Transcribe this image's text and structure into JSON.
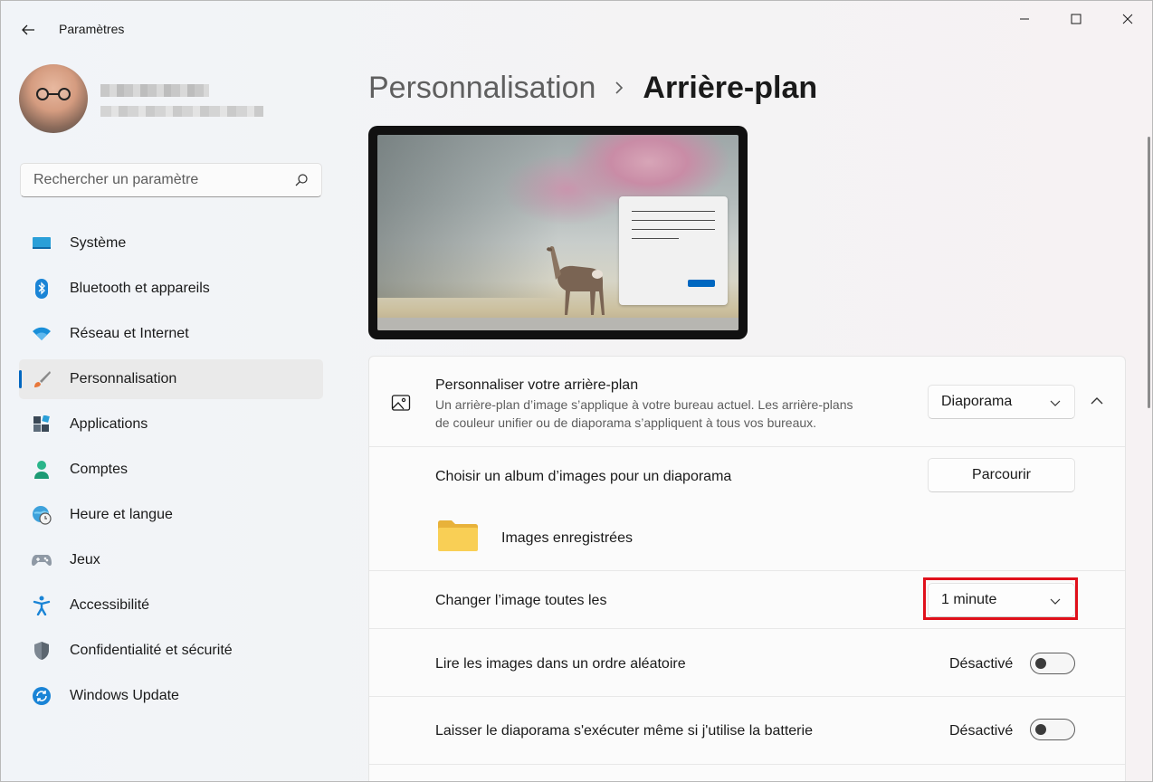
{
  "window": {
    "title": "Paramètres"
  },
  "search": {
    "placeholder": "Rechercher un paramètre"
  },
  "sidebar": {
    "items": [
      {
        "label": "Système",
        "icon": "monitor-icon"
      },
      {
        "label": "Bluetooth et appareils",
        "icon": "bluetooth-icon"
      },
      {
        "label": "Réseau et Internet",
        "icon": "wifi-icon"
      },
      {
        "label": "Personnalisation",
        "icon": "paintbrush-icon",
        "active": true
      },
      {
        "label": "Applications",
        "icon": "apps-icon"
      },
      {
        "label": "Comptes",
        "icon": "person-icon"
      },
      {
        "label": "Heure et langue",
        "icon": "globe-clock-icon"
      },
      {
        "label": "Jeux",
        "icon": "gamepad-icon"
      },
      {
        "label": "Accessibilité",
        "icon": "accessibility-icon"
      },
      {
        "label": "Confidentialité et sécurité",
        "icon": "shield-icon"
      },
      {
        "label": "Windows Update",
        "icon": "update-icon"
      }
    ]
  },
  "breadcrumb": {
    "parent": "Personnalisation",
    "current": "Arrière-plan"
  },
  "background_section": {
    "title": "Personnaliser votre arrière-plan",
    "description_line1": "Un arrière-plan d’image s’applique à votre bureau actuel. Les arrière-plans",
    "description_line2": "de couleur unifier ou de diaporama s’appliquent à tous vos bureaux.",
    "selected": "Diaporama"
  },
  "album": {
    "label": "Choisir un album d’images pour un diaporama",
    "browse_label": "Parcourir",
    "folder_name": "Images enregistrées"
  },
  "interval": {
    "label": "Changer l’image toutes les",
    "selected": "1 minute"
  },
  "shuffle": {
    "label": "Lire les images dans un ordre aléatoire",
    "state": "Désactivé"
  },
  "battery": {
    "label": "Laisser le diaporama s'exécuter même si j'utilise la batterie",
    "state": "Désactivé"
  },
  "colors": {
    "accent": "#0067c0",
    "highlight": "#e0101b"
  }
}
